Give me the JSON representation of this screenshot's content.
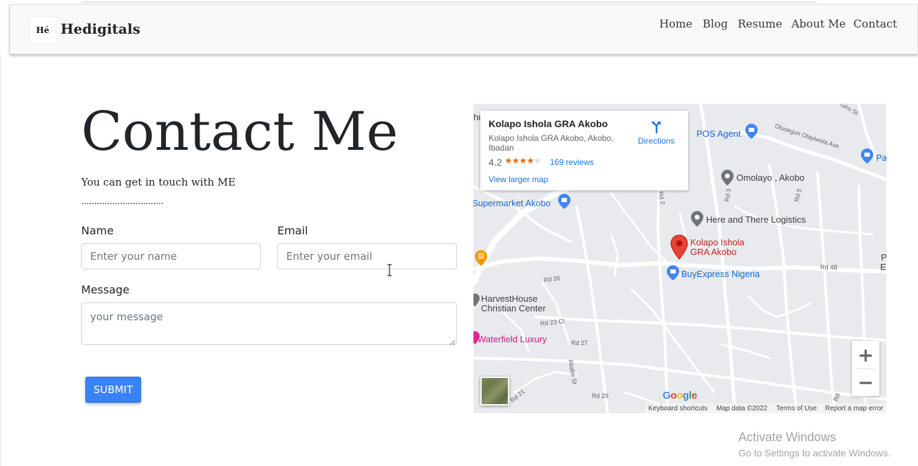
{
  "brand": {
    "logo_text": "Hé",
    "name": "Hedigitals"
  },
  "nav": {
    "items": [
      "Home",
      "Blog",
      "Resume",
      "About Me",
      "Contact"
    ]
  },
  "contact": {
    "title": "Contact Me",
    "subtitle": "You can get in touch with ME",
    "dots": "................................",
    "name_label": "Name",
    "name_placeholder": "Enter your name",
    "email_label": "Email",
    "email_placeholder": "Enter your email",
    "message_label": "Message",
    "message_placeholder": "your message",
    "submit_label": "SUBMIT"
  },
  "map": {
    "place": {
      "name": "Kolapo Ishola GRA Akobo",
      "address": "Kolapo Ishola GRA Akobo, Akobo, Ibadan",
      "rating": "4.2",
      "rating_value": 4.2,
      "reviews": "169 reviews",
      "view_larger": "View larger map",
      "directions": "Directions"
    },
    "labels": {
      "pos_agent": "POS Agent",
      "omolayo": "Omolayo , Akobo",
      "supermarket": "Supermarket Akobo",
      "here_there": "Here and There Logistics",
      "pin_line1": "Kolapo Ishola",
      "pin_line2": "GRA Akobo",
      "buyexpress": "BuyExpress Nigeria",
      "harvest1": "HarvestHouse",
      "harvest2": "Christian Center",
      "waterfield": "Waterfield Luxury",
      "pa": "Pa",
      "est_p": "P",
      "est": "Esta",
      "hu": "hu"
    },
    "roads": {
      "olusegun": "Olusegun Olayiwola Ave",
      "giro": "Giro St",
      "rd2": "Rd 2",
      "rd3": "Rd 3",
      "rd5": "Rd 5",
      "rd26": "Rd 26",
      "rd4b": "Rd 4B",
      "rd23cl": "Rd 23 Cl",
      "rd27": "Rd 27",
      "abake": "Abake St",
      "rd21": "Rd 21",
      "rd29": "Rd 29",
      "rd": "Rd"
    },
    "zoom_in": "+",
    "zoom_out": "−",
    "google": [
      "G",
      "o",
      "o",
      "g",
      "l",
      "e"
    ],
    "google_colors": [
      "#4285f4",
      "#ea4335",
      "#fbbc05",
      "#4285f4",
      "#34a853",
      "#ea4335"
    ],
    "footer": {
      "shortcuts": "Keyboard shortcuts",
      "mapdata": "Map data ©2022",
      "terms": "Terms of Use",
      "report": "Report a map error"
    },
    "colors": {
      "pin": "#ea4335",
      "shop": "#4285f4",
      "grey_poi": "#70757a",
      "restaurant": "#f29900",
      "pink_poi": "#e52592"
    }
  },
  "windows": {
    "title": "Activate Windows",
    "subtitle": "Go to Settings to activate Windows."
  },
  "colors": {
    "submit": "#3b82f6",
    "text": "#212529",
    "navbar_bg": "#f8f9fa"
  }
}
